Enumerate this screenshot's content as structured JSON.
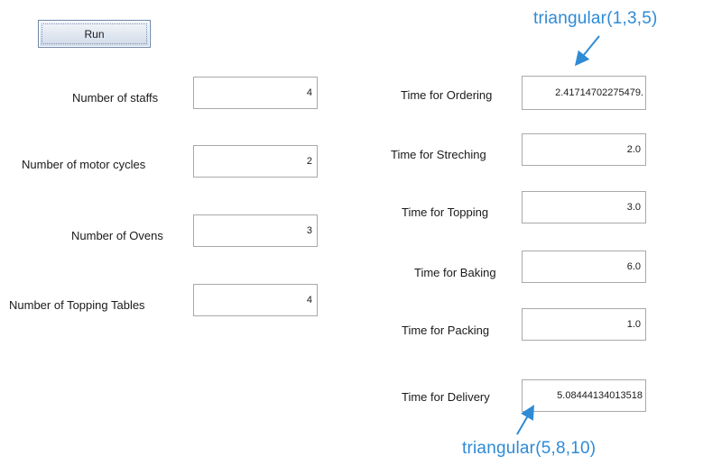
{
  "toolbar": {
    "run_label": "Run"
  },
  "left_fields": [
    {
      "label": "Number of staffs",
      "value": "4"
    },
    {
      "label": "Number of motor cycles",
      "value": "2"
    },
    {
      "label": "Number of Ovens",
      "value": "3"
    },
    {
      "label": "Number of Topping Tables",
      "value": "4"
    }
  ],
  "right_fields": [
    {
      "label": "Time for Ordering",
      "value": "2.41714702275479."
    },
    {
      "label": "Time for Streching",
      "value": "2.0"
    },
    {
      "label": "Time for Topping",
      "value": "3.0"
    },
    {
      "label": "Time for Baking",
      "value": "6.0"
    },
    {
      "label": "Time for Packing",
      "value": "1.0"
    },
    {
      "label": "Time for Delivery",
      "value": "5.08444134013518"
    }
  ],
  "annotations": {
    "ordering_note": "triangular(1,3,5)",
    "delivery_note": "triangular(5,8,10)",
    "color": "#2e8bd6"
  }
}
